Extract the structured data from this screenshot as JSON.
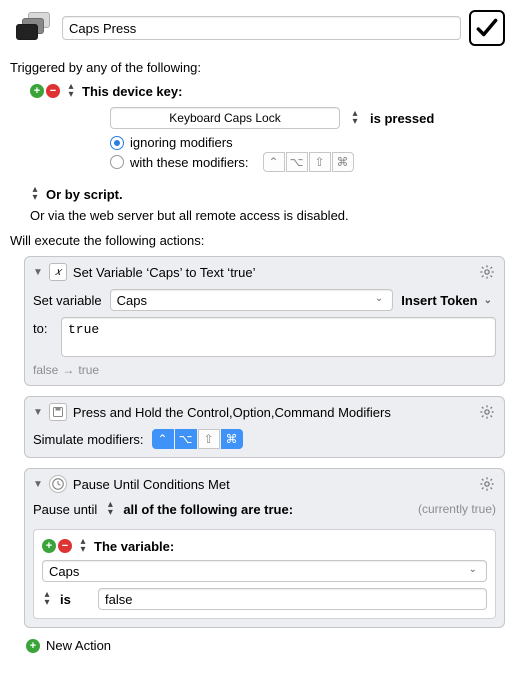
{
  "header": {
    "title_value": "Caps Press"
  },
  "trigger": {
    "intro_label": "Triggered by any of the following:",
    "device_key_label": "This device key:",
    "device_key_value": "Keyboard Caps Lock",
    "pressed_label": "is pressed",
    "opt_ignore": "ignoring modifiers",
    "opt_with": "with these modifiers:",
    "or_script": "Or by script.",
    "web_note": "Or via the web server but all remote access is disabled.",
    "modifiers": {
      "ctrl": "⌃",
      "opt": "⌥",
      "shift": "⇧",
      "cmd": "⌘"
    }
  },
  "exec_label": "Will execute the following actions:",
  "a1": {
    "title": "Set Variable ‘Caps’ to Text ‘true’",
    "field_label": "Set variable",
    "var_value": "Caps",
    "insert_token": "Insert Token",
    "to_label": "to:",
    "to_value": "true",
    "preview_from": "false",
    "preview_to": "true"
  },
  "a2": {
    "title": "Press and Hold the Control,Option,Command Modifiers",
    "sim_label": "Simulate modifiers:"
  },
  "a3": {
    "title": "Pause Until Conditions Met",
    "pause_label": "Pause until",
    "mode_label": "all of the following are true:",
    "status": "(currently true)",
    "var_label": "The variable:",
    "var_value": "Caps",
    "op_label": "is",
    "rhs_value": "false"
  },
  "new_action_label": "New Action"
}
